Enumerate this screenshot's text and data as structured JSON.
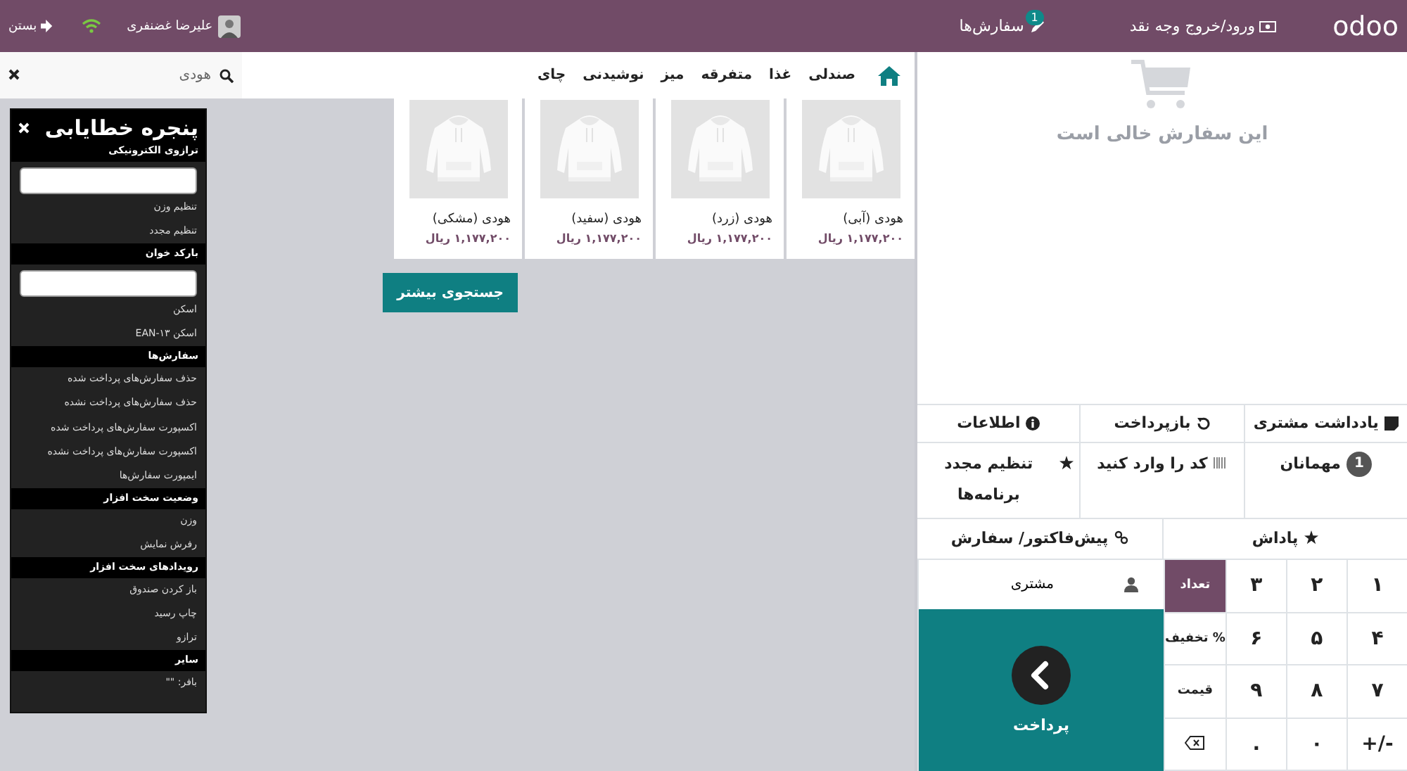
{
  "header": {
    "logo": "odoo",
    "cash_button": "ورود/خروج وجه نقد",
    "orders_button": {
      "label": "سفارش‌ها",
      "badge": "1"
    },
    "user_name": "علیرضا غضنفری",
    "close_button": "بستن"
  },
  "categories": [
    {
      "label": "صندلی"
    },
    {
      "label": "غذا"
    },
    {
      "label": "متفرقه"
    },
    {
      "label": "میز"
    },
    {
      "label": "نوشیدنی"
    },
    {
      "label": "چای"
    }
  ],
  "search": {
    "value": "هودی"
  },
  "products": [
    {
      "name": "هودی (آبی)",
      "price": "۱,۱۷۷,۲۰۰ ریال"
    },
    {
      "name": "هودی (زرد)",
      "price": "۱,۱۷۷,۲۰۰ ریال"
    },
    {
      "name": "هودی (سفید)",
      "price": "۱,۱۷۷,۲۰۰ ریال"
    },
    {
      "name": "هودی (مشکی)",
      "price": "۱,۱۷۷,۲۰۰ ریال"
    }
  ],
  "load_more_button": "جستجوی بیشتر",
  "order": {
    "empty_message": "این سفارش خالی است"
  },
  "control_rows": [
    [
      {
        "kind": "note",
        "label": "یادداشت مشتری"
      },
      {
        "kind": "refund",
        "label": "بازپرداخت"
      },
      {
        "kind": "info",
        "label": "اطلاعات"
      }
    ],
    [
      {
        "kind": "guests",
        "label": "مهمانان",
        "badge": "1"
      },
      {
        "kind": "code",
        "label": "کد را وارد کنید"
      },
      {
        "kind": "reset",
        "label": "تنظیم مجدد برنامه‌ها"
      }
    ],
    [
      {
        "kind": "reward",
        "label": "پاداش"
      },
      {
        "kind": "quotation",
        "label": "پیش‌فاکتور/ سفارش"
      }
    ]
  ],
  "customer_button": "مشتری",
  "pay_button": "پرداخت",
  "numpad": [
    {
      "kind": "digit",
      "label": "۱"
    },
    {
      "kind": "digit",
      "label": "۲"
    },
    {
      "kind": "digit",
      "label": "۳"
    },
    {
      "kind": "mode",
      "label": "تعداد",
      "selected": true
    },
    {
      "kind": "digit",
      "label": "۴"
    },
    {
      "kind": "digit",
      "label": "۵"
    },
    {
      "kind": "digit",
      "label": "۶"
    },
    {
      "kind": "mode",
      "label": "% تخفیف",
      "selected": false
    },
    {
      "kind": "digit",
      "label": "۷"
    },
    {
      "kind": "digit",
      "label": "۸"
    },
    {
      "kind": "digit",
      "label": "۹"
    },
    {
      "kind": "mode",
      "label": "قیمت",
      "selected": false
    },
    {
      "kind": "digit",
      "label": "-/+"
    },
    {
      "kind": "digit",
      "label": "۰"
    },
    {
      "kind": "digit",
      "label": "."
    },
    {
      "kind": "backspace"
    }
  ],
  "debug_window": {
    "title": "پنجره خطایابی",
    "rows": [
      {
        "kind": "heading",
        "label": "ترازوی الکترونیکی"
      },
      {
        "kind": "input"
      },
      {
        "kind": "item",
        "label": "تنظیم وزن"
      },
      {
        "kind": "item",
        "label": "تنظیم مجدد"
      },
      {
        "kind": "heading",
        "label": "بارکد خوان"
      },
      {
        "kind": "input"
      },
      {
        "kind": "item",
        "label": "اسکن"
      },
      {
        "kind": "item",
        "label": "اسکن EAN-۱۳"
      },
      {
        "kind": "heading",
        "label": "سفارش‌ها"
      },
      {
        "kind": "item",
        "label": "حذف سفارش‌های پرداخت شده"
      },
      {
        "kind": "item",
        "label": "حذف سفارش‌های پرداخت نشده"
      },
      {
        "kind": "item",
        "label": "اکسپورت سفارش‌های پرداخت شده"
      },
      {
        "kind": "item",
        "label": "اکسپورت سفارش‌های پرداخت نشده"
      },
      {
        "kind": "item",
        "label": "ایمپورت سفارش‌ها"
      },
      {
        "kind": "heading",
        "label": "وضعیت سخت افزار"
      },
      {
        "kind": "item",
        "label": "وزن"
      },
      {
        "kind": "item",
        "label": "رفرش نمایش"
      },
      {
        "kind": "heading",
        "label": "رویدادهای سخت افزار"
      },
      {
        "kind": "item",
        "label": "باز کردن صندوق"
      },
      {
        "kind": "item",
        "label": "چاپ رسید"
      },
      {
        "kind": "item",
        "label": "ترازو"
      },
      {
        "kind": "heading",
        "label": "سایر"
      },
      {
        "kind": "item",
        "label": "بافر: \"\""
      }
    ]
  }
}
